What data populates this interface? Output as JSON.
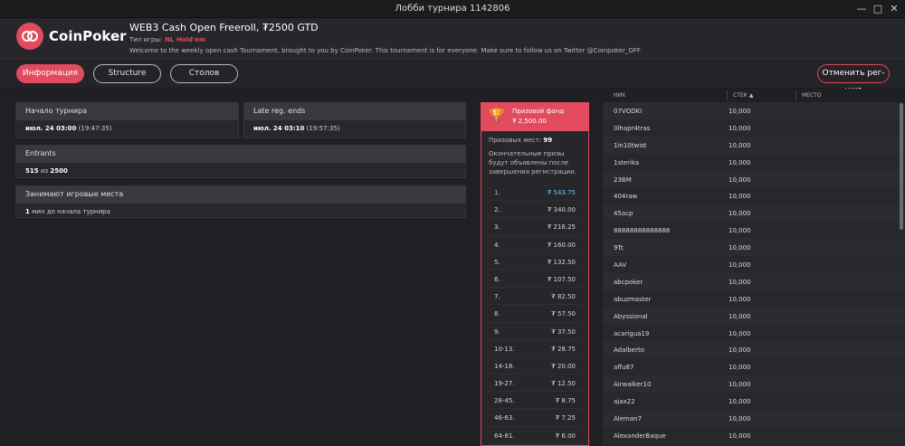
{
  "window": {
    "title": "Лобби турнира 1142806"
  },
  "brand": {
    "name": "CoinPoker"
  },
  "tournament": {
    "name": "WEB3 Cash Open Freeroll, ₮2500 GTD",
    "type_label": "Тип игры:",
    "type_value": "NL Hold'em",
    "description": "Welcome to the weekly open cash Tournament, brought to you by CoinPoker. This tournament is for everyone. Make sure to follow us on Twitter @Coinpoker_OFF"
  },
  "tabs": [
    {
      "label": "Информация",
      "active": true
    },
    {
      "label": "Structure",
      "active": false
    },
    {
      "label": "Столов",
      "active": false
    }
  ],
  "cancel_label": "Отменить рег-цию",
  "info": {
    "start_label": "Начало турнира",
    "start_value": "июл. 24 03:00",
    "start_local": "(19:47:35)",
    "late_label": "Late reg. ends",
    "late_value": "июл. 24 03:10",
    "late_local": "(19:57:35)",
    "entrants_label": "Entrants",
    "entrants_count": "515",
    "entrants_of": "из",
    "entrants_max": "2500",
    "places_label": "Занимают игровые места",
    "places_value": "1",
    "places_suffix": "мин до начала турнира"
  },
  "prize": {
    "title": "Призовой фонд",
    "amount": "₮ 2,500.00",
    "places_label": "Призовых мест:",
    "places_count": "99",
    "note": "Окончательные призы будут объявлены после завершения регистрации.",
    "rows": [
      {
        "place": "1.",
        "value": "₮ 543.75"
      },
      {
        "place": "2.",
        "value": "₮ 340.00"
      },
      {
        "place": "3.",
        "value": "₮ 216.25"
      },
      {
        "place": "4.",
        "value": "₮ 160.00"
      },
      {
        "place": "5.",
        "value": "₮ 132.50"
      },
      {
        "place": "6.",
        "value": "₮ 107.50"
      },
      {
        "place": "7.",
        "value": "₮ 82.50"
      },
      {
        "place": "8.",
        "value": "₮ 57.50"
      },
      {
        "place": "9.",
        "value": "₮ 37.50"
      },
      {
        "place": "10-13.",
        "value": "₮ 28.75"
      },
      {
        "place": "14-18.",
        "value": "₮ 20.00"
      },
      {
        "place": "19-27.",
        "value": "₮ 12.50"
      },
      {
        "place": "28-45.",
        "value": "₮ 8.75"
      },
      {
        "place": "46-63.",
        "value": "₮ 7.25"
      },
      {
        "place": "64-81.",
        "value": "₮ 6.00"
      }
    ]
  },
  "players": {
    "headers": {
      "nick": "НИК",
      "stack": "СТЕК",
      "place": "МЕСТО"
    },
    "rows": [
      {
        "nick": "07VODKI",
        "stack": "10,000"
      },
      {
        "nick": "0lhapr4tras",
        "stack": "10,000"
      },
      {
        "nick": "1in10twist",
        "stack": "10,000"
      },
      {
        "nick": "1sterika",
        "stack": "10,000"
      },
      {
        "nick": "23BM",
        "stack": "10,000"
      },
      {
        "nick": "404raw",
        "stack": "10,000"
      },
      {
        "nick": "45acp",
        "stack": "10,000"
      },
      {
        "nick": "88888888888888",
        "stack": "10,000"
      },
      {
        "nick": "9Tc",
        "stack": "10,000"
      },
      {
        "nick": "AAV",
        "stack": "10,000"
      },
      {
        "nick": "abcpoker",
        "stack": "10,000"
      },
      {
        "nick": "abuzmaster",
        "stack": "10,000"
      },
      {
        "nick": "Abyssional",
        "stack": "10,000"
      },
      {
        "nick": "acarigua19",
        "stack": "10,000"
      },
      {
        "nick": "Adalberto",
        "stack": "10,000"
      },
      {
        "nick": "affu87",
        "stack": "10,000"
      },
      {
        "nick": "Airwalker10",
        "stack": "10,000"
      },
      {
        "nick": "ajax22",
        "stack": "10,000"
      },
      {
        "nick": "Aleman7",
        "stack": "10,000"
      },
      {
        "nick": "AlexanderBaque",
        "stack": "10,000"
      }
    ]
  }
}
